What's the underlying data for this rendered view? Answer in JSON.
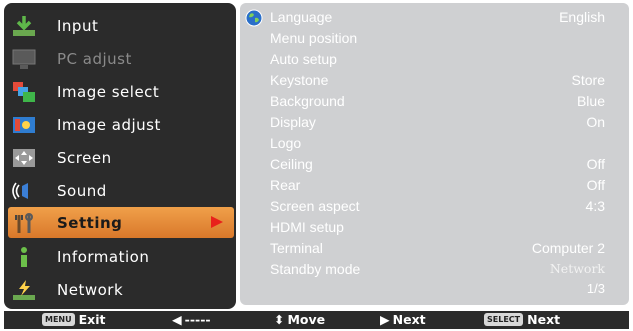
{
  "menu": {
    "items": [
      {
        "label": "Input",
        "state": "normal",
        "icon": "input-icon"
      },
      {
        "label": "PC adjust",
        "state": "disabled",
        "icon": "pc-adjust-icon"
      },
      {
        "label": "Image select",
        "state": "normal",
        "icon": "image-select-icon"
      },
      {
        "label": "Image adjust",
        "state": "normal",
        "icon": "image-adjust-icon"
      },
      {
        "label": "Screen",
        "state": "normal",
        "icon": "screen-icon"
      },
      {
        "label": "Sound",
        "state": "normal",
        "icon": "sound-icon"
      },
      {
        "label": "Setting",
        "state": "selected",
        "icon": "setting-icon"
      },
      {
        "label": "Information",
        "state": "normal",
        "icon": "information-icon"
      },
      {
        "label": "Network",
        "state": "normal",
        "icon": "network-icon"
      }
    ]
  },
  "settings": {
    "rows": [
      {
        "label": "Language",
        "value": "English"
      },
      {
        "label": "Menu position",
        "value": ""
      },
      {
        "label": "Auto setup",
        "value": ""
      },
      {
        "label": "Keystone",
        "value": "Store"
      },
      {
        "label": "Background",
        "value": "Blue"
      },
      {
        "label": "Display",
        "value": "On"
      },
      {
        "label": "Logo",
        "value": ""
      },
      {
        "label": "Ceiling",
        "value": "Off"
      },
      {
        "label": "Rear",
        "value": "Off"
      },
      {
        "label": "Screen aspect",
        "value": "4:3"
      },
      {
        "label": "HDMI setup",
        "value": ""
      },
      {
        "label": "Terminal",
        "value": "Computer 2"
      },
      {
        "label": "Standby mode",
        "value": "Network"
      }
    ],
    "page": "1/3"
  },
  "bottom_bar": {
    "exit_key": "MENU",
    "exit_label": "Exit",
    "back_label": "-----",
    "move_label": "Move",
    "next_label": "Next",
    "select_key": "SELECT",
    "select_label": "Next"
  },
  "colors": {
    "menu_bg": "#2b2b2b",
    "panel_bg": "#cfd0d2",
    "selected_bg": "#e58a35",
    "arrow_red": "#e8221b"
  }
}
